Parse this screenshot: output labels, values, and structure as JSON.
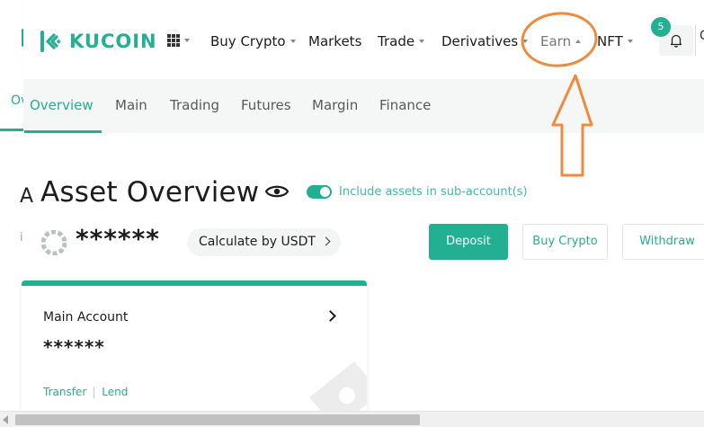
{
  "colors": {
    "brand": "#23af91",
    "annotation": "#f08a3c"
  },
  "header": {
    "logo_text": "KUCOIN",
    "nav": [
      {
        "label": "Buy Crypto"
      },
      {
        "label": "Markets"
      },
      {
        "label": "Trade"
      },
      {
        "label": "Derivatives"
      },
      {
        "label": "Earn"
      },
      {
        "label": "NFT"
      }
    ],
    "notification_count": "5",
    "right_cut_text": "C"
  },
  "background_page": {
    "cut_tab_text": "Ov",
    "cut_title_text": "A",
    "cut_line_text": "i"
  },
  "subnav": {
    "tabs": [
      {
        "label": "Overview"
      },
      {
        "label": "Main"
      },
      {
        "label": "Trading"
      },
      {
        "label": "Futures"
      },
      {
        "label": "Margin"
      },
      {
        "label": "Finance"
      }
    ]
  },
  "overview": {
    "title": "Asset Overview",
    "include_sub_label": "Include assets in sub-account(s)",
    "hidden_balance": "******",
    "calculate_label": "Calculate by USDT",
    "deposit_label": "Deposit",
    "buy_label": "Buy Crypto",
    "withdraw_label": "Withdraw"
  },
  "main_account": {
    "title": "Main Account",
    "balance": "******",
    "transfer_label": "Transfer",
    "lend_label": "Lend"
  }
}
